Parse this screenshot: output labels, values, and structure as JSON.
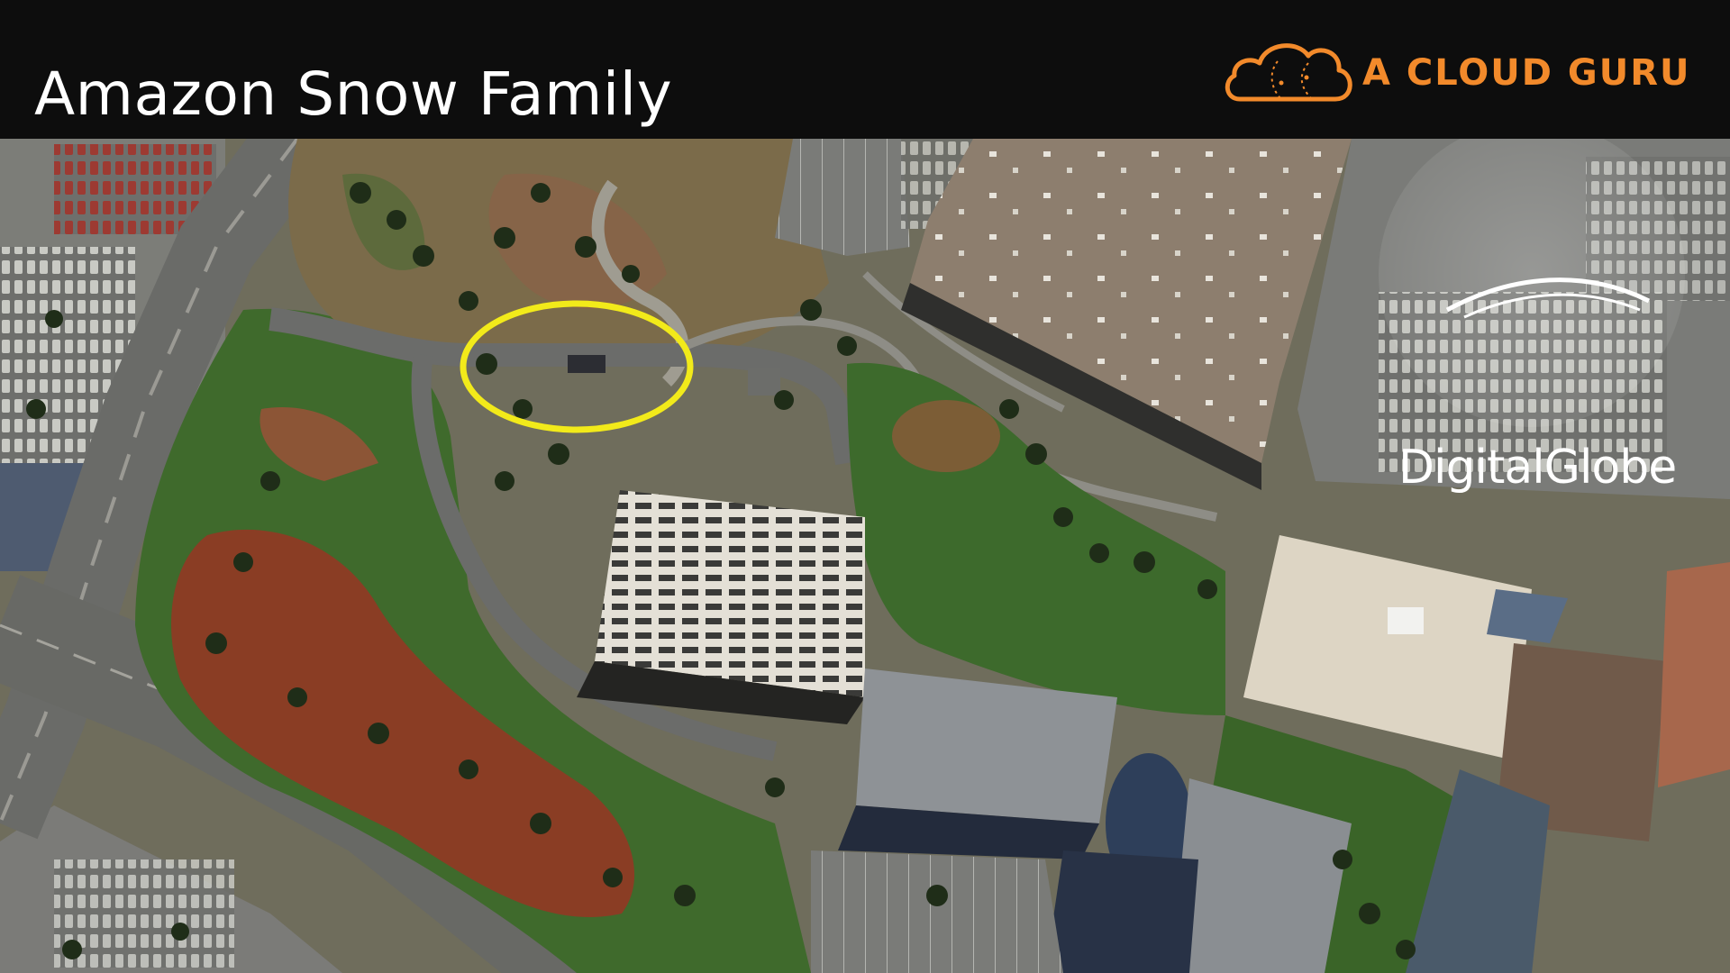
{
  "slide": {
    "title": "Amazon Snow Family",
    "brand": {
      "name": "A CLOUD GURU",
      "logo_icon": "cloud-logo-icon",
      "color": "#f28a2b"
    }
  },
  "image": {
    "description_icon": "satellite-photo",
    "watermark": "DigitalGlobe",
    "highlight": {
      "shape": "ellipse",
      "color": "#f2ea1a"
    }
  }
}
